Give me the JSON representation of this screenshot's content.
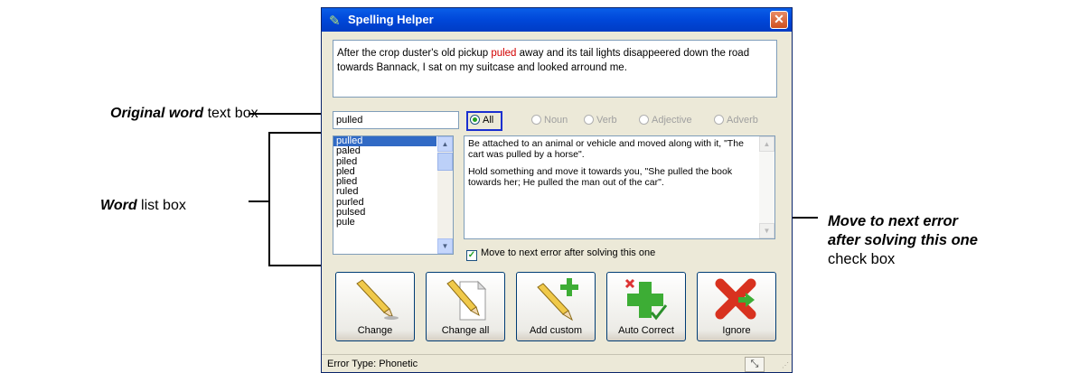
{
  "annotations": {
    "original_word": {
      "bold": "Original word",
      "rest": " text box"
    },
    "word_list": {
      "bold": "Word",
      "rest": " list box"
    },
    "move_next": {
      "line1": "Move to next error",
      "line2": "after solving this one",
      "line3": "check box"
    }
  },
  "window": {
    "title": "Spelling Helper",
    "close_glyph": "✕",
    "sentence_before": "After the crop duster's old pickup ",
    "sentence_error": "puled",
    "sentence_after": " away and its tail lights disappeered down the road towards Bannack, I sat on my suitcase and looked arround me.",
    "original_word_value": "pulled",
    "word_filters": [
      {
        "label": "All",
        "selected": true
      },
      {
        "label": "Noun",
        "selected": false
      },
      {
        "label": "Verb",
        "selected": false
      },
      {
        "label": "Adjective",
        "selected": false
      },
      {
        "label": "Adverb",
        "selected": false
      }
    ],
    "word_list": [
      "pulled",
      "paled",
      "piled",
      "pled",
      "plied",
      "ruled",
      "purled",
      "pulsed",
      "pule"
    ],
    "definitions": [
      "Be attached to an animal or vehicle and moved along with it, \"The cart was pulled by a horse\".",
      "Hold something and move it towards you, \"She pulled the book towards her; He pulled the man out of the car\"."
    ],
    "move_next_label": "Move to next error after solving this one",
    "move_next_checked": true,
    "buttons": {
      "change": "Change",
      "change_all": "Change all",
      "add_custom": "Add custom",
      "auto_correct": "Auto Correct",
      "ignore": "Ignore"
    },
    "status": "Error Type: Phonetic"
  }
}
